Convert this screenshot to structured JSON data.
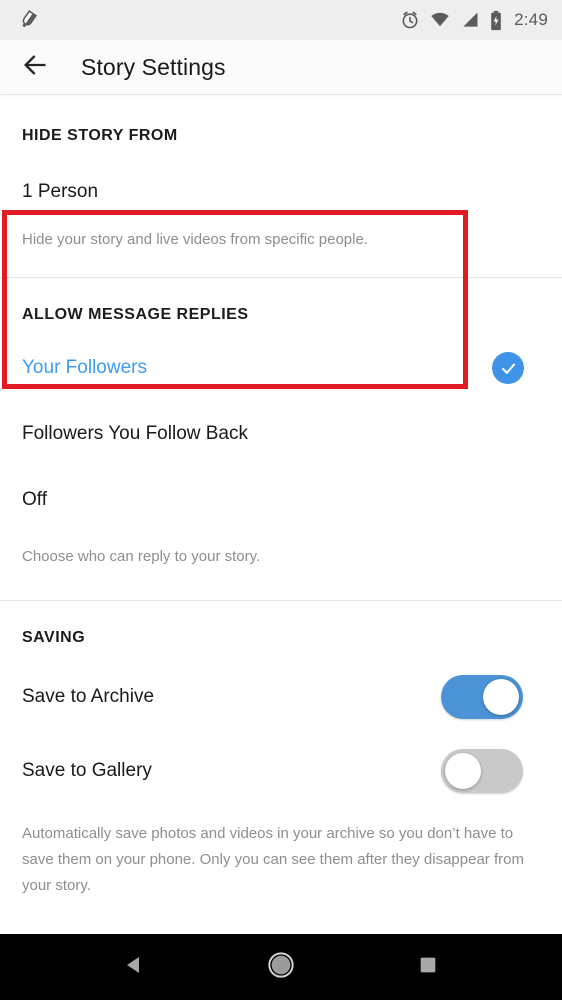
{
  "status_bar": {
    "left_icons": [
      {
        "name": "screenshot-capture-icon"
      }
    ],
    "right_icons": [
      {
        "name": "alarm-clock-icon"
      },
      {
        "name": "wifi-icon"
      },
      {
        "name": "cellular-signal-icon"
      },
      {
        "name": "battery-charging-icon"
      }
    ],
    "time": "2:49"
  },
  "app_bar": {
    "back_icon": "back-arrow-icon",
    "title": "Story Settings"
  },
  "highlight": {
    "color": "#e11b22",
    "target": "hide-story-from-section"
  },
  "sections": {
    "hide_story": {
      "header": "HIDE STORY FROM",
      "value": "1 Person",
      "description": "Hide your story and live videos from specific people."
    },
    "allow_message_replies": {
      "header": "ALLOW MESSAGE REPLIES",
      "options": [
        {
          "label": "Your Followers",
          "selected": true
        },
        {
          "label": "Followers You Follow Back",
          "selected": false
        },
        {
          "label": "Off",
          "selected": false
        }
      ],
      "selected_color": "#3e9bf0",
      "check_icon": "check-circle-icon",
      "description": "Choose who can reply to your story."
    },
    "saving": {
      "header": "SAVING",
      "toggles": [
        {
          "label": "Save to Archive",
          "on": true
        },
        {
          "label": "Save to Gallery",
          "on": false
        }
      ],
      "toggle_on_color": "#4b93d6",
      "toggle_off_color": "#c9c9c9",
      "description": "Automatically save photos and videos in your archive so you don’t have to save them on your phone. Only you can see them after they disappear from your story."
    }
  },
  "nav_bar": {
    "buttons": [
      {
        "name": "nav-back-button",
        "icon": "triangle-back-icon"
      },
      {
        "name": "nav-home-button",
        "icon": "circle-home-icon"
      },
      {
        "name": "nav-recents-button",
        "icon": "square-recents-icon"
      }
    ]
  }
}
